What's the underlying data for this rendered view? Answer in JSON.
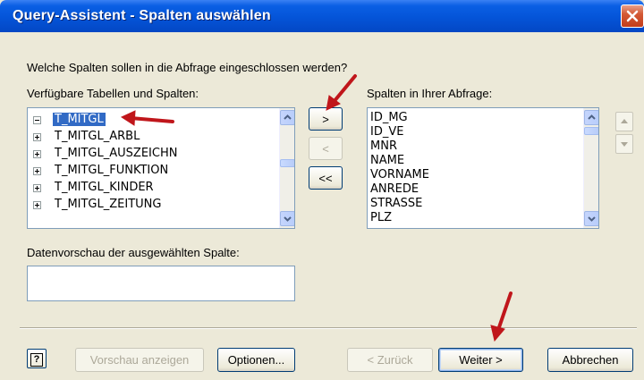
{
  "window": {
    "title": "Query-Assistent - Spalten auswählen"
  },
  "prompt": "Welche Spalten sollen in die Abfrage eingeschlossen werden?",
  "available": {
    "label": "Verfügbare Tabellen und Spalten:",
    "items": [
      {
        "name": "T_MITGL",
        "state": "expanded",
        "selected": true
      },
      {
        "name": "T_MITGL_ARBL",
        "state": "collapsed"
      },
      {
        "name": "T_MITGL_AUSZEICHN",
        "state": "collapsed"
      },
      {
        "name": "T_MITGL_FUNKTION",
        "state": "collapsed"
      },
      {
        "name": "T_MITGL_KINDER",
        "state": "collapsed"
      },
      {
        "name": "T_MITGL_ZEITUNG",
        "state": "collapsed"
      }
    ]
  },
  "move_buttons": {
    "add": ">",
    "remove": "<",
    "remove_all": "<<"
  },
  "query_columns": {
    "label": "Spalten in Ihrer Abfrage:",
    "items": [
      "ID_MG",
      "ID_VE",
      "MNR",
      "NAME",
      "VORNAME",
      "ANREDE",
      "STRASSE",
      "PLZ"
    ]
  },
  "preview": {
    "label": "Datenvorschau der ausgewählten Spalte:",
    "value": ""
  },
  "footer": {
    "help": "?",
    "preview_button": "Vorschau anzeigen",
    "options_button": "Optionen...",
    "back_button": "< Zurück",
    "next_button": "Weiter >",
    "cancel_button": "Abbrechen"
  },
  "colors": {
    "titlebar": "#0454d8",
    "selection": "#316ac5",
    "annotation_arrow": "#c0161b",
    "dialog_bg": "#ece9d8"
  }
}
